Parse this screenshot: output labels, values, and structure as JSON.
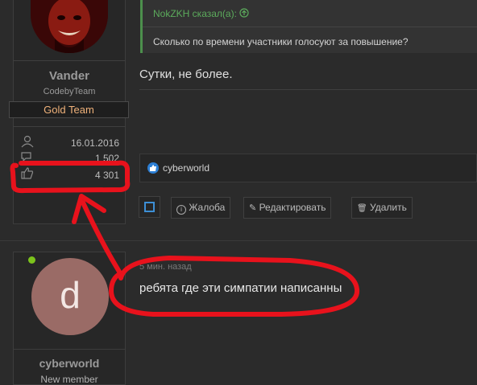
{
  "post1": {
    "user": {
      "name": "Vander",
      "role": "CodebyTeam",
      "banner": "Gold Team"
    },
    "stats": [
      {
        "icon": "user-icon",
        "value": "16.01.2016"
      },
      {
        "icon": "messages-icon",
        "value": "1 502"
      },
      {
        "icon": "thumbs-up-icon",
        "value": "4 301"
      }
    ],
    "quote": {
      "author": "NokZKH сказал(а):",
      "text": "Сколько по времени участники голосуют за повышение?"
    },
    "message": "Сутки, не более.",
    "reaction": {
      "user": "cyberworld"
    },
    "actions": {
      "report": "Жалоба",
      "edit": "Редактировать",
      "delete": "Удалить"
    }
  },
  "post2": {
    "user": {
      "name": "cyberworld",
      "role": "New member",
      "avatar_letter": "d"
    },
    "time": "5 мин. назад",
    "message": "ребята где эти симпатии написанны"
  },
  "colors": {
    "annotation": "#e8121c",
    "accent": "#3d8fd6",
    "banner_text": "#f0b27a",
    "online": "#7cc31c"
  }
}
